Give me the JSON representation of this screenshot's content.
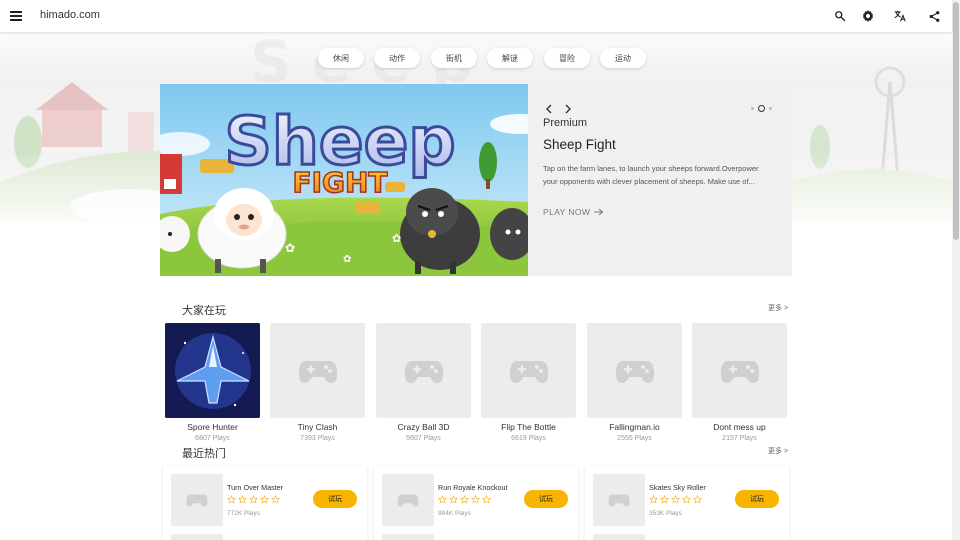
{
  "header": {
    "site_title": "himado.com"
  },
  "categories": [
    "休闲",
    "动作",
    "街机",
    "解谜",
    "冒险",
    "运动"
  ],
  "hero": {
    "game_title_art": "Sheep",
    "game_subtitle_art": "FIGHT",
    "label": "Premium",
    "title": "Sheep Fight",
    "description": "Tap on the farm lanes, to launch your sheeps forward.Overpower your opponents with clever placement of sheeps. Make use of...",
    "play_label": "PLAY NOW",
    "slide_count": 3,
    "active_slide": 2
  },
  "popular": {
    "title": "大家在玩",
    "more": "更多 >",
    "games": [
      {
        "name": "Spore Hunter",
        "plays": "6807 Plays",
        "has_image": true
      },
      {
        "name": "Tiny Clash",
        "plays": "7393 Plays",
        "has_image": false
      },
      {
        "name": "Crazy Ball 3D",
        "plays": "5607 Plays",
        "has_image": false
      },
      {
        "name": "Flip The Bottle",
        "plays": "6619 Plays",
        "has_image": false
      },
      {
        "name": "Fallingman.io",
        "plays": "2555 Plays",
        "has_image": false
      },
      {
        "name": "Dont mess up",
        "plays": "2157 Plays",
        "has_image": false
      }
    ]
  },
  "recent": {
    "title": "最近热门",
    "more": "更多 >",
    "games": [
      {
        "name": "Turn Over Master",
        "plays": "772K Plays",
        "rating": 0,
        "button": "试玩"
      },
      {
        "name": "Run Royale Knockout",
        "plays": "984K Plays",
        "rating": 0,
        "button": "试玩"
      },
      {
        "name": "Skates Sky Roller",
        "plays": "353K Plays",
        "rating": 0,
        "button": "试玩"
      }
    ]
  },
  "colors": {
    "accent": "#f7b500",
    "star": "#f2b632",
    "placeholder": "#ececec"
  },
  "icons": [
    "menu-icon",
    "search-icon",
    "settings-icon",
    "translate-icon",
    "share-icon",
    "chevron-left-icon",
    "chevron-right-icon",
    "arrow-right-icon",
    "gamepad-icon",
    "star-outline-icon"
  ]
}
